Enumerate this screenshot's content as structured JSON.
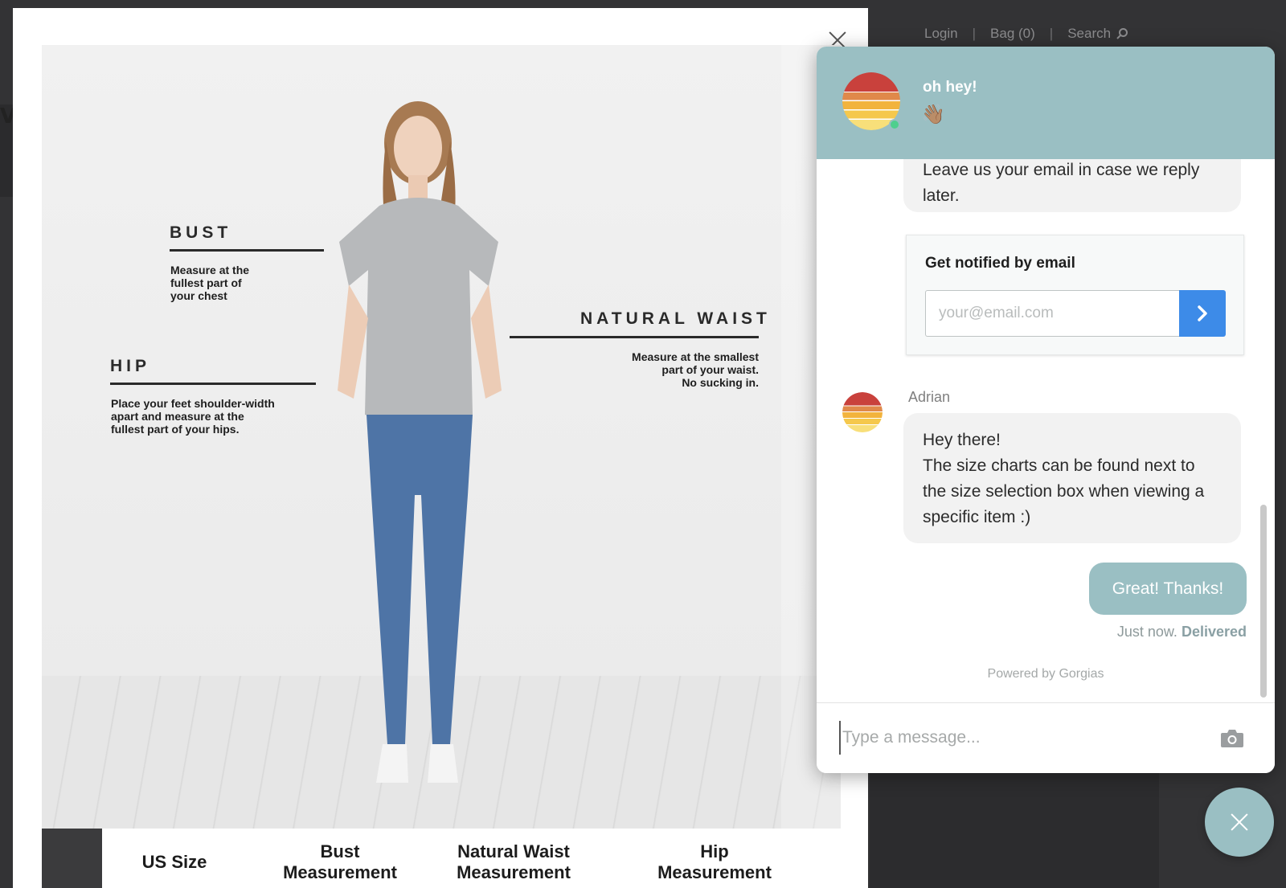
{
  "site": {
    "nav": {
      "login": "Login",
      "sep": "|",
      "bag": "Bag (0)",
      "search": "Search"
    },
    "partial_heading": "V"
  },
  "size_chart": {
    "labels": {
      "bust": "BUST",
      "bust_desc": "Measure at the\nfullest part of\nyour chest",
      "waist": "NATURAL WAIST",
      "waist_desc": "Measure at the smallest\npart of your waist.\nNo sucking in.",
      "hip": "HIP",
      "hip_desc": "Place your feet shoulder-width\napart and measure at the\nfullest part of your hips."
    },
    "columns": [
      "US Size",
      "Bust\nMeasurement",
      "Natural Waist\nMeasurement",
      "Hip\nMeasurement"
    ]
  },
  "chat": {
    "header": {
      "greeting": "oh hey!",
      "emoji": "👋🏽"
    },
    "messages": {
      "top_bubble": "Leave us your email in case we reply later.",
      "notify_title": "Get notified by email",
      "email_placeholder": "your@email.com",
      "agent_name": "Adrian",
      "agent_message": "Hey there!\nThe size charts can be found next to the size selection box when viewing a specific item :)",
      "user_message": "Great! Thanks!",
      "status_time": "Just now.",
      "status_delivered": "Delivered"
    },
    "powered_by": "Powered by Gorgias",
    "composer_placeholder": "Type a message..."
  },
  "colors": {
    "chat_accent": "#9abfc3",
    "submit_blue": "#3d8be8",
    "online_green": "#4fcf8e"
  },
  "icons": {
    "close": "close-icon",
    "search": "search-icon",
    "arrow": "chevron-right-icon",
    "camera": "camera-icon"
  }
}
